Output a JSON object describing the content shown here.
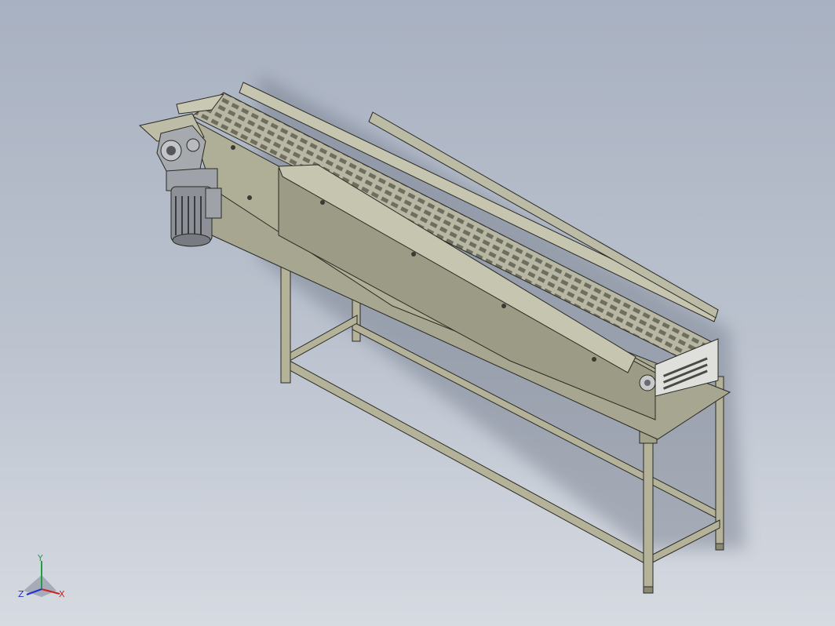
{
  "viewport": {
    "background_top": "#a8b1c1",
    "background_bottom": "#d6dae1"
  },
  "model": {
    "body_color": "#b4b39a",
    "shade_color": "#8a8a73",
    "edge_color": "#2a2a24",
    "motor_color": "#8d9096"
  },
  "triad": {
    "x_label": "X",
    "y_label": "Y",
    "z_label": "Z",
    "x_color": "#d02020",
    "y_color": "#20a040",
    "z_color": "#2030d0"
  }
}
